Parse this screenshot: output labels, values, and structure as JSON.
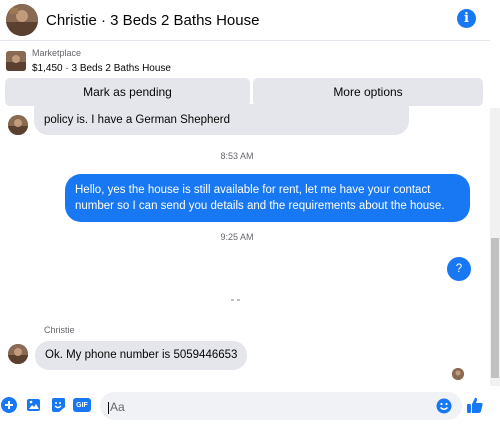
{
  "header": {
    "title": "Christie · 3 Beds 2 Baths House",
    "info_icon": "info-icon"
  },
  "listing": {
    "label": "Marketplace",
    "subtitle": "$1,450 · 3 Beds 2 Baths House"
  },
  "actions": {
    "pending_label": "Mark as pending",
    "more_label": "More options"
  },
  "messages": {
    "incoming_partial": "policy is. I have a German Shepherd",
    "time_1": "8:53 AM",
    "outgoing_1": "Hello, yes the house is still available for rent, let me have your contact number so I can send you details and the requirements about the house.",
    "time_2": "9:25 AM",
    "outgoing_2": "?",
    "sender_name": "Christie",
    "incoming_2": "Ok. My phone number is 5059446653"
  },
  "composer": {
    "placeholder": "Aa",
    "icons": [
      "plus-icon",
      "image-icon",
      "sticker-icon",
      "gif-icon",
      "emoji-icon",
      "thumbs-up-icon"
    ],
    "gif_text": "GIF"
  },
  "colors": {
    "accent": "#1877f2",
    "bubble_gray": "#e4e6eb",
    "muted_text": "#65676b"
  }
}
